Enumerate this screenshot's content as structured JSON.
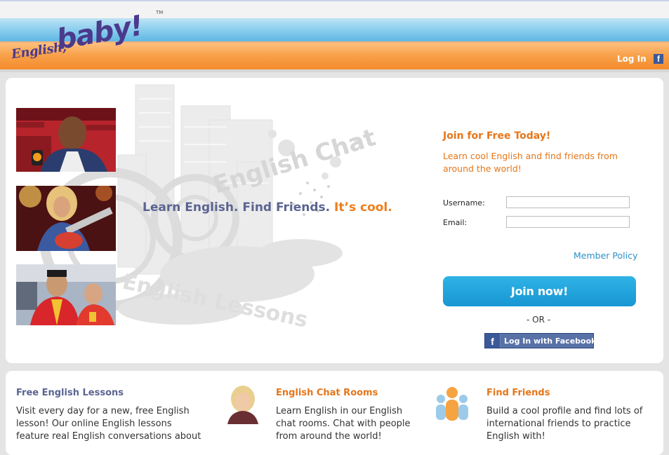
{
  "header": {
    "logo": {
      "word1": "English,",
      "word2": "baby!",
      "tm": "TM"
    },
    "login_label": "Log In",
    "facebook_icon": "facebook-icon"
  },
  "hero": {
    "art_text_1": "English Chat",
    "art_text_2": "English Lessons",
    "tagline_main": "Learn English. Find Friends.",
    "tagline_accent": "It’s cool.",
    "photos": [
      "basketball-player-photo",
      "guitar-singer-photo",
      "athletes-photo"
    ]
  },
  "signup": {
    "title": "Join for Free Today!",
    "subtitle": "Learn cool English and find friends from around the world!",
    "username_label": "Username:",
    "username_value": "",
    "email_label": "Email:",
    "email_value": "",
    "member_policy": "Member Policy",
    "join_button": "Join now!",
    "or_text": "- OR -",
    "facebook_button": "Log In with Facebook"
  },
  "features": [
    {
      "title": "Free English Lessons",
      "text": "Visit every day for a new, free English lesson! Our online English lessons feature real English conversations about",
      "color": "#5b6491"
    },
    {
      "title": "English Chat Rooms",
      "text": "Learn English in our English chat rooms. Chat with people from around the world!",
      "color": "#e5761a"
    },
    {
      "title": "Find Friends",
      "text": "Build a cool profile and find lots of international friends to practice English with!",
      "color": "#e5761a"
    }
  ],
  "colors": {
    "orange": "#e5761a",
    "blue_accent": "#2f8fc7",
    "facebook": "#3b5998",
    "navy_text": "#5b6491"
  }
}
